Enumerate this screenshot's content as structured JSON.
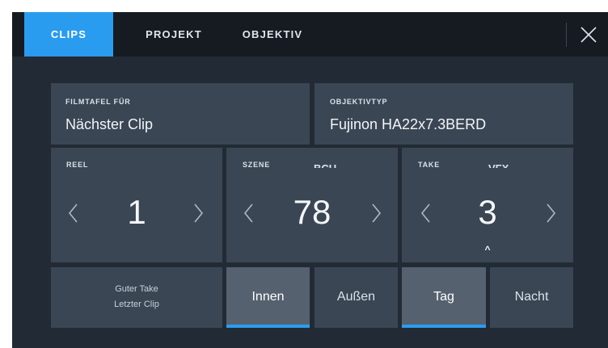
{
  "tabs": [
    {
      "label": "CLIPS",
      "active": true
    },
    {
      "label": "PROJEKT",
      "active": false
    },
    {
      "label": "OBJEKTIV",
      "active": false
    }
  ],
  "close_icon": "close-icon",
  "slate_for": {
    "label": "FILMTAFEL FÜR",
    "value": "Nächster Clip"
  },
  "lens_type": {
    "label": "OBJEKTIVTYP",
    "value": "Fujinon HA22x7.3BERD"
  },
  "reel": {
    "label": "REEL",
    "value": "1"
  },
  "scene": {
    "label": "SZENE",
    "value": "78",
    "suffix": "BCU"
  },
  "take": {
    "label": "TAKE",
    "value": "3",
    "suffix": "VFX",
    "mark": "^"
  },
  "good_take": {
    "line1": "Guter Take",
    "line2": "Letzter Clip"
  },
  "location_buttons": [
    {
      "label": "Innen",
      "active": true
    },
    {
      "label": "Außen",
      "active": false
    }
  ],
  "time_buttons": [
    {
      "label": "Tag",
      "active": true
    },
    {
      "label": "Nacht",
      "active": false
    }
  ],
  "colors": {
    "accent": "#2a9cf0",
    "panel": "#3a4654",
    "background": "#222b35"
  }
}
